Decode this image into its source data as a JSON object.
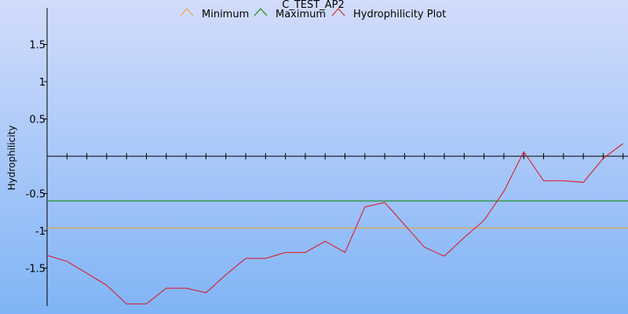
{
  "chart_data": {
    "type": "line",
    "title": "C_TEST_AP2",
    "xlabel": "",
    "ylabel": "Hydrophilicity",
    "ylim": [
      -2.0,
      2.0
    ],
    "yticks": [
      {
        "value": 1.5,
        "label": "1.5"
      },
      {
        "value": 1.0,
        "label": "1"
      },
      {
        "value": 0.5,
        "label": "0.5"
      },
      {
        "value": -0.5,
        "label": "-0.5"
      },
      {
        "value": -1.0,
        "label": "-1"
      },
      {
        "value": -1.5,
        "label": "-1.5"
      }
    ],
    "x": [
      1,
      2,
      3,
      4,
      5,
      6,
      7,
      8,
      9,
      10,
      11,
      12,
      13,
      14,
      15,
      16,
      17,
      18,
      19,
      20,
      21,
      22,
      23,
      24,
      25,
      26,
      27,
      28,
      29,
      30,
      31,
      32
    ],
    "xlim": [
      1,
      32
    ],
    "legend_position": "top",
    "series": [
      {
        "name": "Minimum",
        "color": "#f0a030",
        "values": [
          -0.96,
          -0.96,
          -0.96,
          -0.96,
          -0.96,
          -0.96,
          -0.96,
          -0.96,
          -0.96,
          -0.96,
          -0.96,
          -0.96,
          -0.96,
          -0.96,
          -0.96,
          -0.96,
          -0.96,
          -0.96,
          -0.96,
          -0.96,
          -0.96,
          -0.96,
          -0.96,
          -0.96,
          -0.96,
          -0.96,
          -0.96,
          -0.96,
          -0.96,
          -0.96,
          -0.96,
          -0.96
        ]
      },
      {
        "name": "Maximum",
        "color": "#008000",
        "values": [
          -0.6,
          -0.6,
          -0.6,
          -0.6,
          -0.6,
          -0.6,
          -0.6,
          -0.6,
          -0.6,
          -0.6,
          -0.6,
          -0.6,
          -0.6,
          -0.6,
          -0.6,
          -0.6,
          -0.6,
          -0.6,
          -0.6,
          -0.6,
          -0.6,
          -0.6,
          -0.6,
          -0.6,
          -0.6,
          -0.6,
          -0.6,
          -0.6,
          -0.6,
          -0.6,
          -0.6,
          -0.6
        ]
      },
      {
        "name": "Hydrophilicity Plot",
        "color": "#e0101a",
        "values": [
          -1.33,
          -1.41,
          -1.57,
          -1.73,
          -1.98,
          -1.98,
          -1.77,
          -1.77,
          -1.83,
          -1.59,
          -1.37,
          -1.37,
          -1.29,
          -1.29,
          -1.14,
          -1.29,
          -0.68,
          -0.62,
          -0.92,
          -1.22,
          -1.34,
          -1.09,
          -0.86,
          -0.47,
          0.06,
          -0.33,
          -0.33,
          -0.35,
          -0.03,
          0.17
        ]
      }
    ]
  }
}
